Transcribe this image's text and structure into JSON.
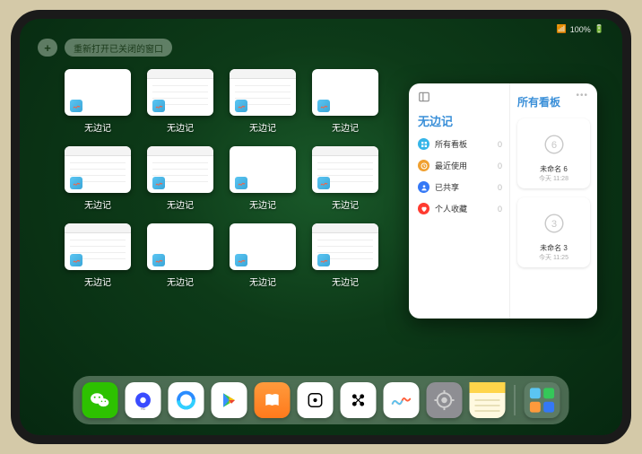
{
  "status": {
    "signal": "•••",
    "wifi": "100%",
    "battery": "■"
  },
  "top_controls": {
    "plus": "+",
    "reopen_window": "重新打开已关闭的窗口"
  },
  "windows": [
    {
      "label": "无边记",
      "variant": "blank"
    },
    {
      "label": "无边记",
      "variant": "calendar"
    },
    {
      "label": "无边记",
      "variant": "calendar"
    },
    {
      "label": "无边记",
      "variant": "blank"
    },
    {
      "label": "无边记",
      "variant": "calendar"
    },
    {
      "label": "无边记",
      "variant": "calendar"
    },
    {
      "label": "无边记",
      "variant": "blank"
    },
    {
      "label": "无边记",
      "variant": "calendar"
    },
    {
      "label": "无边记",
      "variant": "calendar"
    },
    {
      "label": "无边记",
      "variant": "blank"
    },
    {
      "label": "无边记",
      "variant": "blank"
    },
    {
      "label": "无边记",
      "variant": "calendar"
    }
  ],
  "panel": {
    "left_title": "无边记",
    "right_title": "所有看板",
    "items": [
      {
        "label": "所有看板",
        "count": "0",
        "color": "#36b5e8",
        "icon": "grid"
      },
      {
        "label": "最近使用",
        "count": "0",
        "color": "#f0a030",
        "icon": "clock"
      },
      {
        "label": "已共享",
        "count": "0",
        "color": "#3478f6",
        "icon": "person"
      },
      {
        "label": "个人收藏",
        "count": "0",
        "color": "#ff3b30",
        "icon": "heart"
      }
    ],
    "boards": [
      {
        "name": "未命名 6",
        "sub": "今天 11:28",
        "digit": "6"
      },
      {
        "name": "未命名 3",
        "sub": "今天 11:25",
        "digit": "3"
      }
    ]
  },
  "dock": [
    {
      "name": "wechat",
      "bg": "#2dc100"
    },
    {
      "name": "quark",
      "bg": "#ffffff"
    },
    {
      "name": "qq-browser",
      "bg": "#ffffff"
    },
    {
      "name": "play",
      "bg": "#ffffff"
    },
    {
      "name": "books",
      "bg": "linear-gradient(#ff9a3c,#ff7a1c)"
    },
    {
      "name": "dice",
      "bg": "#ffffff"
    },
    {
      "name": "connect",
      "bg": "#ffffff"
    },
    {
      "name": "freeform",
      "bg": "#ffffff"
    },
    {
      "name": "settings",
      "bg": "#8e8e93"
    },
    {
      "name": "notes",
      "bg": "#fff9e0"
    },
    {
      "name": "app-library",
      "bg": "rgba(120,150,130,0.4)"
    }
  ]
}
